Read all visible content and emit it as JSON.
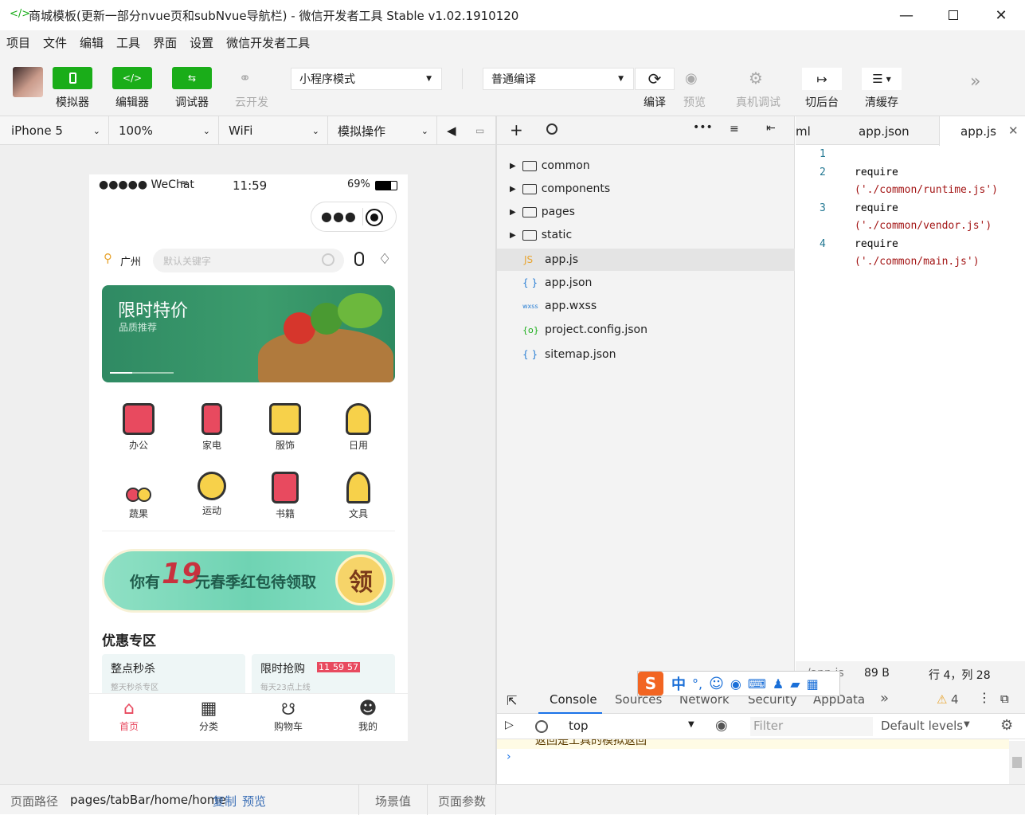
{
  "window": {
    "title": "商城模板(更新一部分nvue页和subNvue导航栏) - 微信开发者工具 Stable v1.02.1910120"
  },
  "menu": [
    "项目",
    "文件",
    "编辑",
    "工具",
    "界面",
    "设置",
    "微信开发者工具"
  ],
  "toolbar": {
    "simulator": "模拟器",
    "editor": "编辑器",
    "debugger": "调试器",
    "cloud": "云开发",
    "mode": "小程序模式",
    "compile_mode": "普通编译",
    "compile": "编译",
    "preview": "预览",
    "remote_debug": "真机调试",
    "background": "切后台",
    "clear_cache": "清缓存"
  },
  "devbar": {
    "device": "iPhone 5",
    "zoom": "100%",
    "network": "WiFi",
    "operation": "模拟操作"
  },
  "phone": {
    "carrier": "●●●●● WeChat",
    "time": "11:59",
    "battery": "69%",
    "location": "广州",
    "search_placeholder": "默认关键字",
    "banner_title": "限时特价",
    "banner_sub": "品质推荐",
    "categories": [
      "办公",
      "家电",
      "服饰",
      "日用",
      "蔬果",
      "运动",
      "书籍",
      "文具"
    ],
    "promo_prefix": "你有",
    "promo_amount": "19",
    "promo_text": "元春季红包待领取",
    "promo_btn": "领",
    "section_title": "优惠专区",
    "card1_title": "整点秒杀",
    "card1_sub": "整天秒杀专区",
    "card2_title": "限时抢购",
    "card2_sub": "每天23点上线",
    "countdown": [
      "11",
      "59",
      "57"
    ],
    "tabs": [
      "首页",
      "分类",
      "购物车",
      "我的"
    ]
  },
  "explorer": {
    "folders": [
      "common",
      "components",
      "pages",
      "static"
    ],
    "files": [
      {
        "badge": "JS",
        "name": "app.js"
      },
      {
        "badge": "{ }",
        "name": "app.json"
      },
      {
        "badge": "wxss",
        "name": "app.wxss"
      },
      {
        "badge": "{o}",
        "name": "project.config.json"
      },
      {
        "badge": "{ }",
        "name": "sitemap.json"
      }
    ]
  },
  "editor": {
    "tab_partial": "ml",
    "tab1": "app.json",
    "tab2": "app.js",
    "lines": [
      "1",
      "2",
      "3",
      "4"
    ],
    "keyword": "require",
    "code": [
      "('./common/runtime.js')",
      "('./common/vendor.js')",
      "('./common/main.js')"
    ],
    "status_file": "/app.js",
    "status_size": "89 B",
    "status_pos": "行 4，列 28"
  },
  "console": {
    "tabs": [
      "Console",
      "Sources",
      "Network",
      "Security",
      "AppData"
    ],
    "warn_count": "4",
    "context": "top",
    "filter_placeholder": "Filter",
    "levels": "Default levels",
    "message": "返回是工具的模拟返回"
  },
  "footer": {
    "path_label": "页面路径",
    "path": "pages/tabBar/home/home",
    "copy": "复制",
    "preview": "预览",
    "scene": "场景值",
    "params": "页面参数"
  },
  "ime": {
    "logo": "S",
    "lang": "中"
  },
  "colors": {
    "wechat_green": "#1aad19",
    "brand_red": "#e84a5f",
    "banner_green": "#2f8a63"
  }
}
